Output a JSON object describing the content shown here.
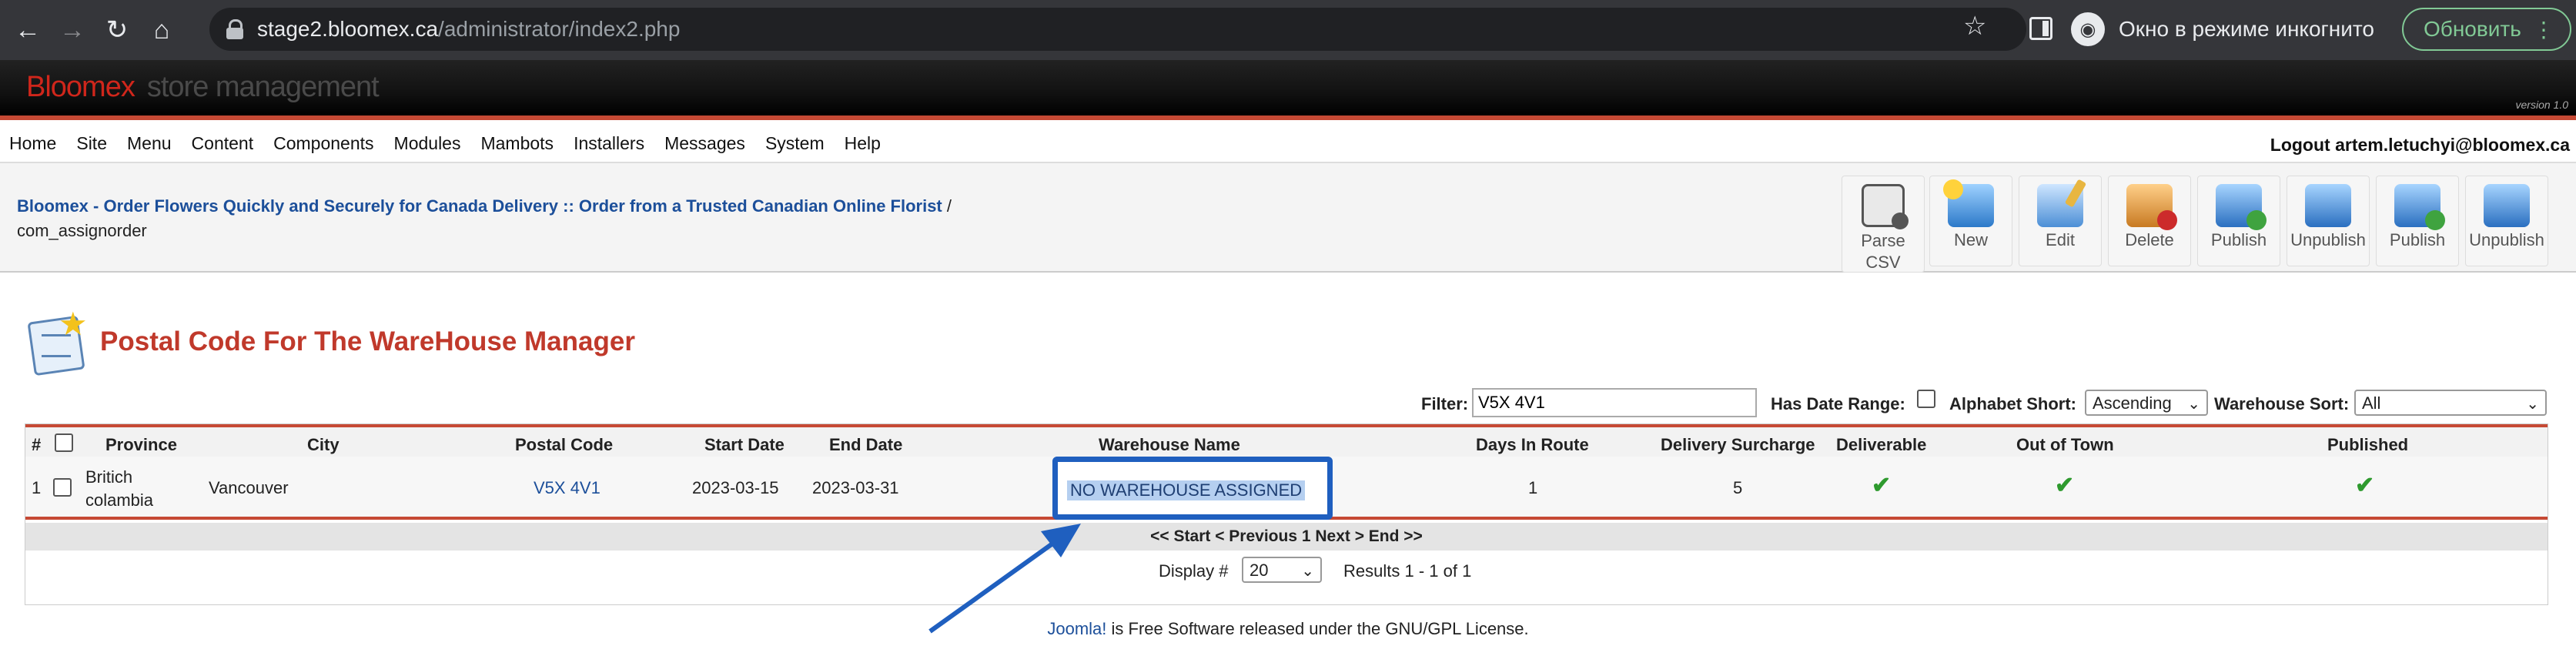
{
  "browser": {
    "url_host": "stage2.bloomex.ca",
    "url_path": "/administrator/index2.php",
    "incognito_label": "Окно в режиме инкогнито",
    "update_label": "Обновить"
  },
  "site": {
    "brand_name": "Bloomex",
    "brand_tagline": "store management",
    "version": "version 1.0"
  },
  "menu": {
    "items": [
      "Home",
      "Site",
      "Menu",
      "Content",
      "Components",
      "Modules",
      "Mambots",
      "Installers",
      "Messages",
      "System",
      "Help"
    ],
    "logout": "Logout artem.letuchyi@bloomex.ca"
  },
  "pathway": {
    "site_link": "Bloomex - Order Flowers Quickly and Securely for Canada Delivery :: Order from a Trusted Canadian Online Florist",
    "separator": "/",
    "component": "com_assignorder"
  },
  "toolbar": {
    "parse_csv": "Parse CSV",
    "new": "New",
    "edit": "Edit",
    "delete": "Delete",
    "publish": "Publish",
    "unpublish": "Unpublish"
  },
  "page": {
    "title": "Postal Code For The WareHouse Manager"
  },
  "filters": {
    "filter_label": "Filter:",
    "filter_value": "V5X 4V1",
    "date_range_label": "Has Date Range:",
    "alphabet_label": "Alphabet Short:",
    "alphabet_value": "Ascending",
    "warehouse_sort_label": "Warehouse Sort:",
    "warehouse_sort_value": "All"
  },
  "table": {
    "headers": {
      "num": "#",
      "province": "Province",
      "city": "City",
      "postal_code": "Postal Code",
      "start_date": "Start Date",
      "end_date": "End Date",
      "warehouse_name": "Warehouse Name",
      "days_in_route": "Days In Route",
      "delivery_surcharge": "Delivery Surcharge",
      "deliverable": "Deliverable",
      "out_of_town": "Out of Town",
      "published": "Published"
    },
    "rows": [
      {
        "num": "1",
        "province_line1": "Britich",
        "province_line2": "colambia",
        "city": "Vancouver",
        "postal_code": "V5X 4V1",
        "start_date": "2023-03-15",
        "end_date": "2023-03-31",
        "warehouse_name": "NO WAREHOUSE ASSIGNED",
        "days_in_route": "1",
        "delivery_surcharge": "5",
        "deliverable": "✔",
        "out_of_town": "✔",
        "published": "✔"
      }
    ]
  },
  "pagination": {
    "text": "<< Start < Previous 1 Next > End >>",
    "display_label": "Display #",
    "display_value": "20",
    "results": "Results 1 - 1 of 1"
  },
  "footer": {
    "link": "Joomla!",
    "text": " is Free Software released under the GNU/GPL License."
  }
}
